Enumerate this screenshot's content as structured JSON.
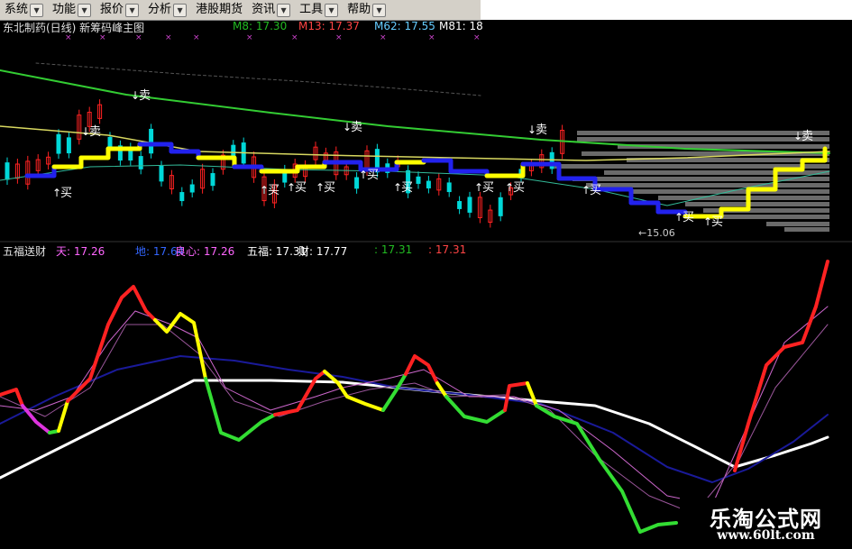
{
  "menu": [
    {
      "label": "系统",
      "has_arrow": true
    },
    {
      "label": "功能",
      "has_arrow": true
    },
    {
      "label": "报价",
      "has_arrow": true
    },
    {
      "label": "分析",
      "has_arrow": true
    },
    {
      "label": "港股期货",
      "has_arrow": false
    },
    {
      "label": "资讯",
      "has_arrow": true
    },
    {
      "label": "工具",
      "has_arrow": true
    },
    {
      "label": "帮助",
      "has_arrow": true
    }
  ],
  "main_chart": {
    "title": "东北制药(日线) 新筹码峰主图",
    "ma_labels": [
      {
        "text": "M8: 17.30",
        "color": "#22bb22"
      },
      {
        "text": "M13: 17.37",
        "color": "#ff4444"
      },
      {
        "text": "M62: 17.55",
        "color": "#66ccff"
      },
      {
        "text": "M81: 18",
        "color": "#ffffff"
      }
    ],
    "sell_label": "卖",
    "buy_label": "买",
    "low_price_label": "←15.06"
  },
  "indicator": {
    "name": "五福送财",
    "values": [
      {
        "text": "天: 17.26",
        "color": "#ff66ff"
      },
      {
        "text": "地: 17.64",
        "color": "#3366ff"
      },
      {
        "text": "良心: 17.26",
        "color": "#ff66ff"
      },
      {
        "text": "五福: 17.31",
        "color": "#ffffff"
      },
      {
        "text": "财: 17.77",
        "color": "#ffffff"
      },
      {
        "text": ": 17.31",
        "color": "#22bb22"
      },
      {
        "text": ": 17.31",
        "color": "#ff4444"
      }
    ]
  },
  "watermark": {
    "name": "乐淘公式网",
    "url": "www.60lt.com"
  },
  "colors": {
    "rise": "#ff2222",
    "fall": "#00d8d8",
    "ma_green": "#33cc33",
    "ma_yellow": "#d8d860",
    "step_yellow": "#ffff00",
    "step_blue": "#2222ee",
    "white_line": "#ffffff",
    "purple_line": "#cc66cc"
  }
}
